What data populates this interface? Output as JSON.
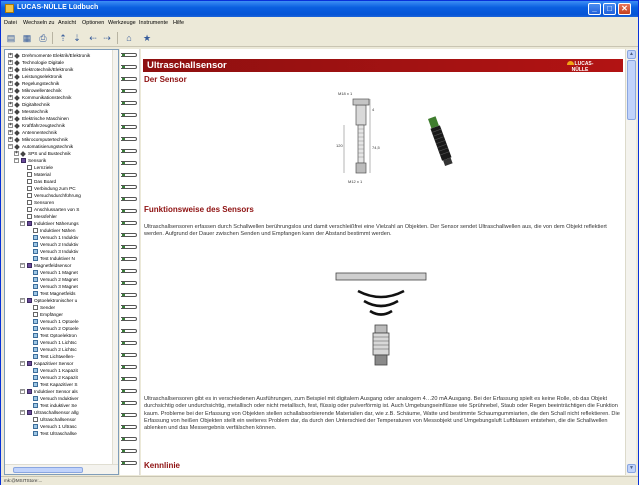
{
  "window": {
    "title": "LUCAS-NÜLLE Lüdbuch",
    "buttons": {
      "minimize": "_",
      "maximize": "□",
      "close": "✕"
    }
  },
  "menu": [
    "Datei",
    "Wechseln zu",
    "Ansicht",
    "Optionen",
    "Werkzeuge",
    "Instrumente",
    "Hilfe"
  ],
  "toolbar": {
    "icons": [
      "show-hide-icon",
      "save-icon",
      "print-icon",
      "up-icon",
      "down-icon",
      "back-icon",
      "forward-icon",
      "home-icon",
      "favorites-icon"
    ]
  },
  "tree": {
    "items": [
      {
        "label": "Drehmomente Elektrik/Elektronik",
        "level": 0,
        "toggle": "+",
        "icon": "dia"
      },
      {
        "label": "Technologie Digitale",
        "level": 0,
        "toggle": "+",
        "icon": "dia"
      },
      {
        "label": "Elektrotechnik/Elektronik",
        "level": 0,
        "toggle": "+",
        "icon": "dia"
      },
      {
        "label": "Leistungselektronik",
        "level": 0,
        "toggle": "+",
        "icon": "dia"
      },
      {
        "label": "Regelungstechnik",
        "level": 0,
        "toggle": "+",
        "icon": "dia"
      },
      {
        "label": "Mikrowellentechnik",
        "level": 0,
        "toggle": "+",
        "icon": "dia"
      },
      {
        "label": "Kommunikationstechnik",
        "level": 0,
        "toggle": "+",
        "icon": "dia"
      },
      {
        "label": "Digitaltechnik",
        "level": 0,
        "toggle": "+",
        "icon": "dia"
      },
      {
        "label": "Messtechnik",
        "level": 0,
        "toggle": "+",
        "icon": "dia"
      },
      {
        "label": "Elektrische Maschinen",
        "level": 0,
        "toggle": "+",
        "icon": "dia"
      },
      {
        "label": "Kraftfahrzeugtechnik",
        "level": 0,
        "toggle": "+",
        "icon": "dia"
      },
      {
        "label": "Antennentechnik",
        "level": 0,
        "toggle": "+",
        "icon": "dia"
      },
      {
        "label": "Mikrocomputertechnik",
        "level": 0,
        "toggle": "+",
        "icon": "dia"
      },
      {
        "label": "Automatisierungstechnik",
        "level": 0,
        "toggle": "−",
        "icon": "dia"
      },
      {
        "label": "SPS und Bustechnik",
        "level": 1,
        "toggle": "+",
        "icon": "dia"
      },
      {
        "label": "Sensorik",
        "level": 1,
        "toggle": "−",
        "icon": "book"
      },
      {
        "label": "Lernziele",
        "level": 2,
        "toggle": "",
        "icon": "page"
      },
      {
        "label": "Material",
        "level": 2,
        "toggle": "",
        "icon": "page"
      },
      {
        "label": "Das Board",
        "level": 2,
        "toggle": "",
        "icon": "page"
      },
      {
        "label": "Verbindung zum PC",
        "level": 2,
        "toggle": "",
        "icon": "page"
      },
      {
        "label": "Versuchsdurchführung",
        "level": 2,
        "toggle": "",
        "icon": "page"
      },
      {
        "label": "Sensoren",
        "level": 2,
        "toggle": "",
        "icon": "page"
      },
      {
        "label": "Anschlussarten von S",
        "level": 2,
        "toggle": "",
        "icon": "page"
      },
      {
        "label": "Messfehler",
        "level": 2,
        "toggle": "",
        "icon": "page"
      },
      {
        "label": "Induktiver Näherungs",
        "level": 2,
        "toggle": "−",
        "icon": "book"
      },
      {
        "label": "Induktiver Nähen",
        "level": 3,
        "toggle": "",
        "icon": "page"
      },
      {
        "label": "Versuch 1 Induktiv",
        "level": 3,
        "toggle": "",
        "icon": "exp"
      },
      {
        "label": "Versuch 2 Induktiv",
        "level": 3,
        "toggle": "",
        "icon": "exp"
      },
      {
        "label": "Versuch 3 Induktiv",
        "level": 3,
        "toggle": "",
        "icon": "exp"
      },
      {
        "label": "Test Induktiver N",
        "level": 3,
        "toggle": "",
        "icon": "exp"
      },
      {
        "label": "Magnetfeldsensor",
        "level": 2,
        "toggle": "−",
        "icon": "book"
      },
      {
        "label": "Versuch 1 Magnet",
        "level": 3,
        "toggle": "",
        "icon": "exp"
      },
      {
        "label": "Versuch 2 Magnet",
        "level": 3,
        "toggle": "",
        "icon": "exp"
      },
      {
        "label": "Versuch 3 Magnet",
        "level": 3,
        "toggle": "",
        "icon": "exp"
      },
      {
        "label": "Test Magnetfelds",
        "level": 3,
        "toggle": "",
        "icon": "exp"
      },
      {
        "label": "Optoelektronischer u",
        "level": 2,
        "toggle": "−",
        "icon": "book"
      },
      {
        "label": "Sender",
        "level": 3,
        "toggle": "",
        "icon": "page"
      },
      {
        "label": "Empfänger",
        "level": 3,
        "toggle": "",
        "icon": "page"
      },
      {
        "label": "Versuch 1 Optoele",
        "level": 3,
        "toggle": "",
        "icon": "exp"
      },
      {
        "label": "Versuch 2 Optoele",
        "level": 3,
        "toggle": "",
        "icon": "exp"
      },
      {
        "label": "Test Optoelektron",
        "level": 3,
        "toggle": "",
        "icon": "exp"
      },
      {
        "label": "Versuch 1 Lichtsc",
        "level": 3,
        "toggle": "",
        "icon": "exp"
      },
      {
        "label": "Versuch 2 Lichtsc",
        "level": 3,
        "toggle": "",
        "icon": "exp"
      },
      {
        "label": "Test Lichtwellen-",
        "level": 3,
        "toggle": "",
        "icon": "exp"
      },
      {
        "label": "Kapazitiver Sensor",
        "level": 2,
        "toggle": "−",
        "icon": "book"
      },
      {
        "label": "Versuch 1 Kapazit",
        "level": 3,
        "toggle": "",
        "icon": "exp"
      },
      {
        "label": "Versuch 2 Kapazit",
        "level": 3,
        "toggle": "",
        "icon": "exp"
      },
      {
        "label": "Test Kapazitiver S",
        "level": 3,
        "toggle": "",
        "icon": "exp"
      },
      {
        "label": "Induktiver Sensor als",
        "level": 2,
        "toggle": "−",
        "icon": "book"
      },
      {
        "label": "Versuch Induktiver",
        "level": 3,
        "toggle": "",
        "icon": "exp"
      },
      {
        "label": "Test induktiver Se",
        "level": 3,
        "toggle": "",
        "icon": "exp"
      },
      {
        "label": "Ultraschallsensor allg",
        "level": 2,
        "toggle": "−",
        "icon": "book"
      },
      {
        "label": "Ultraschallsensor",
        "level": 3,
        "toggle": "",
        "icon": "page"
      },
      {
        "label": "Versuch 1 Ultrasc",
        "level": 3,
        "toggle": "",
        "icon": "exp"
      },
      {
        "label": "Test Ultraschallse",
        "level": 3,
        "toggle": "",
        "icon": "exp"
      }
    ]
  },
  "content": {
    "title": "Ultraschallsensor",
    "logo": "LUCAS-NÜLLE",
    "sections": [
      {
        "heading": "Der Sensor"
      },
      {
        "heading": "Funktionsweise des Sensors"
      },
      {
        "heading": "Kennlinie"
      }
    ],
    "paragraph1": "Ultraschallsensoren erfassen durch Schallwellen berührungslos und damit verschleißfrei eine Vielzahl an Objekten. Der Sensor sendet Ultraschallwellen aus, die von dem Objekt reflektiert werden. Aufgrund der Dauer zwischen Senden und Empfangen kann der Abstand bestimmt werden.",
    "paragraph2": "Ultraschallsensoren gibt es in verschiedenen Ausführungen, zum Beispiel mit digitalem Ausgang oder analogem 4…20 mA Ausgang. Bei der Erfassung spielt es keine Rolle, ob das Objekt durchsichtig oder undurchsichtig, metallisch oder nicht metallisch, fest, flüssig oder pulverförmig ist. Auch Umgebungseinflüsse wie Sprühnebel, Staub oder Regen beeinträchtigen die Funktion kaum. Probleme bei der Erfassung von Objekten stellen schallabsorbierende Materialien dar, wie z.B. Schäume, Watte und bestimmte Schaumgummiarten, die den Schall nicht reflektieren. Die Erfassung von heißen Objekten stellt ein weiteres Problem dar, da durch den Unterschied der Temperaturen von Messobjekt und Umgebungsluft Luftblasen entstehen, die die Schallwellen ablenken und das Messergebnis verfälschen können.",
    "drawing_labels": {
      "thread": "M18 x 1",
      "length": "74,5",
      "diameter": "M12 x 1",
      "dim": "4",
      "width": "120"
    }
  },
  "statusbar": {
    "text": "mk:@MSITStore:..."
  }
}
